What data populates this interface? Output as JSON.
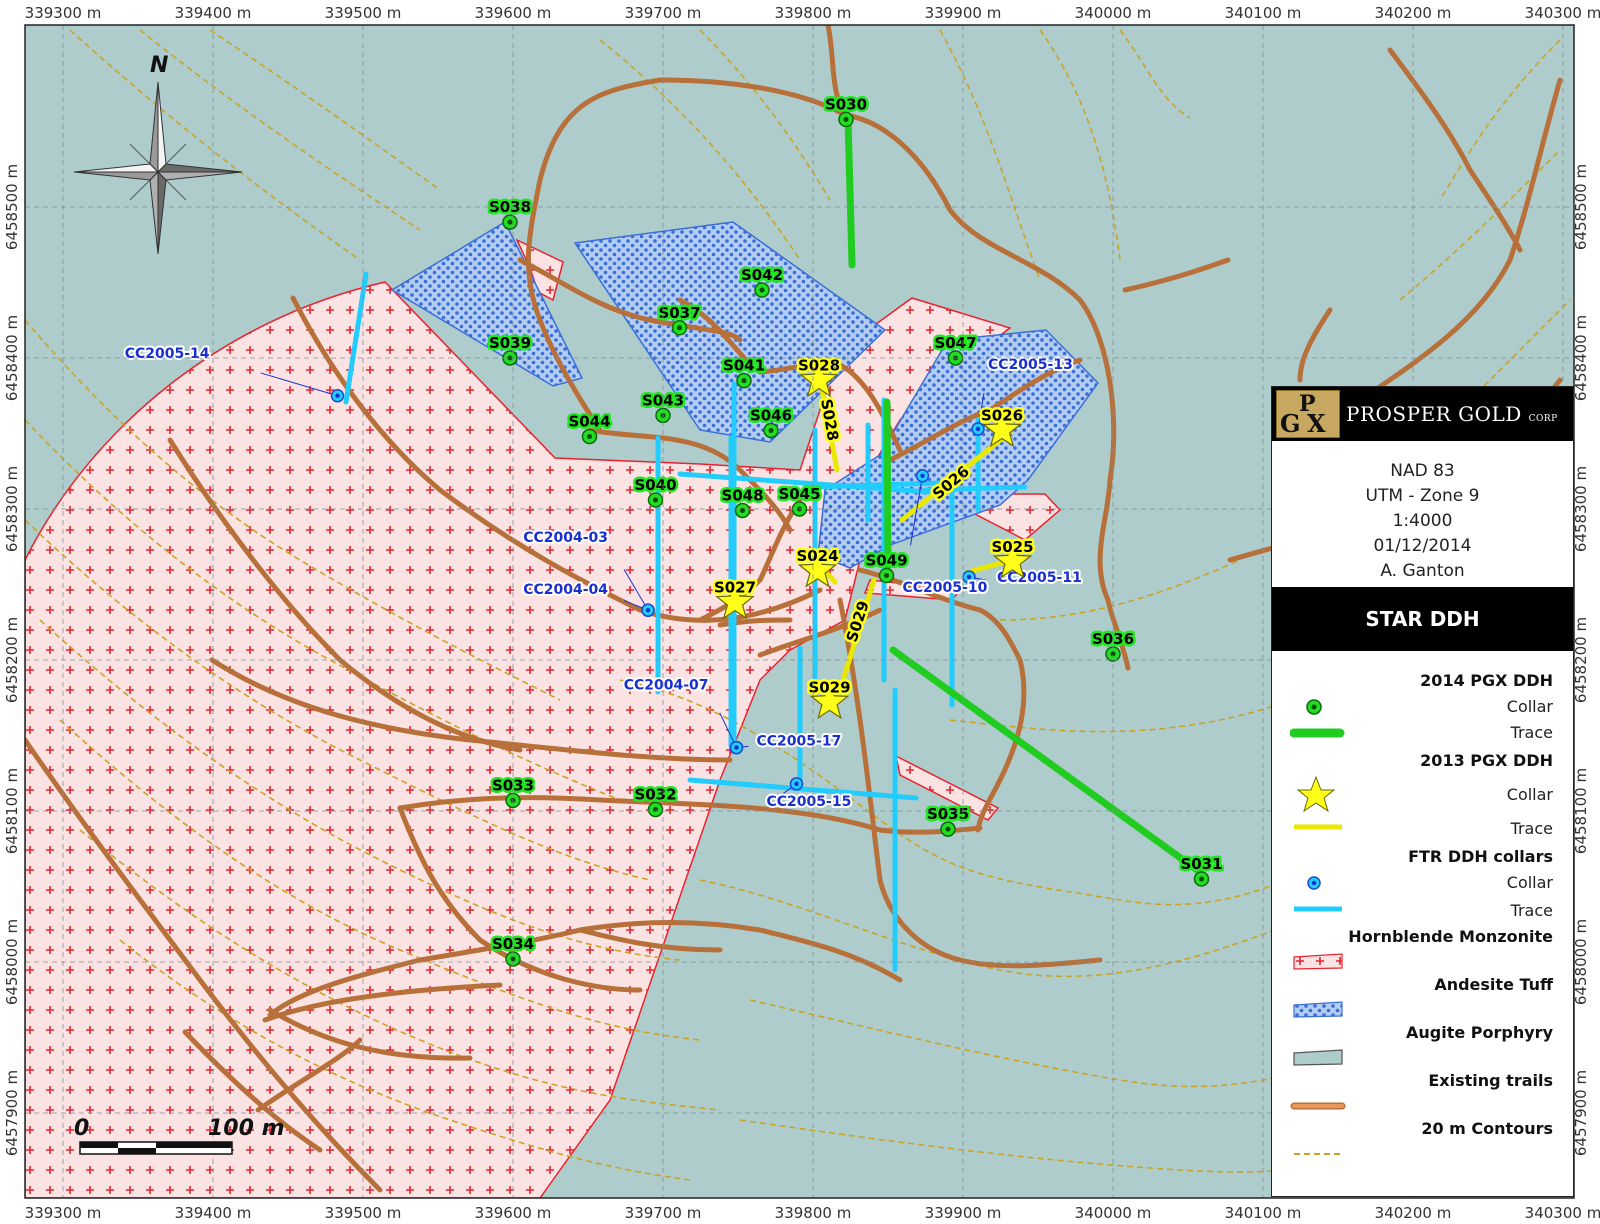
{
  "map": {
    "x_ticks": [
      "339300 m",
      "339400 m",
      "339500 m",
      "339600 m",
      "339700 m",
      "339800 m",
      "339900 m",
      "340000 m",
      "340100 m",
      "340200 m",
      "340300 m"
    ],
    "y_ticks": [
      "6458500 m",
      "6458400 m",
      "6458300 m",
      "6458200 m",
      "6458100 m",
      "6458000 m",
      "6457900 m"
    ],
    "north_label": "N",
    "scale": {
      "zero": "0",
      "end": "100 m"
    },
    "colors": {
      "augite": "#afcccd",
      "monzonite": "#fce3e3",
      "tuff": "#b3cdf2",
      "trail": "#e8995a",
      "contour": "#c9a424",
      "pgx2014": "#22dd22",
      "pgx2013": "#ffff1a",
      "ftr": "#22ccff"
    }
  },
  "holes_2014": [
    {
      "id": "S030",
      "x": 339822,
      "y": 6458558
    },
    {
      "id": "S038",
      "x": 339598,
      "y": 6458490
    },
    {
      "id": "S042",
      "x": 339766,
      "y": 6458445
    },
    {
      "id": "S037",
      "x": 339711,
      "y": 6458420
    },
    {
      "id": "S039",
      "x": 339598,
      "y": 6458400
    },
    {
      "id": "S041",
      "x": 339754,
      "y": 6458385
    },
    {
      "id": "S047",
      "x": 339895,
      "y": 6458400
    },
    {
      "id": "S043",
      "x": 339700,
      "y": 6458362
    },
    {
      "id": "S044",
      "x": 339651,
      "y": 6458348
    },
    {
      "id": "S046",
      "x": 339772,
      "y": 6458352
    },
    {
      "id": "S040",
      "x": 339695,
      "y": 6458306
    },
    {
      "id": "S048",
      "x": 339753,
      "y": 6458299
    },
    {
      "id": "S045",
      "x": 339791,
      "y": 6458300
    },
    {
      "id": "S049",
      "x": 339849,
      "y": 6458256
    },
    {
      "id": "S036",
      "x": 340000,
      "y": 6458204
    },
    {
      "id": "S033",
      "x": 339600,
      "y": 6458107
    },
    {
      "id": "S032",
      "x": 339695,
      "y": 6458101
    },
    {
      "id": "S035",
      "x": 339890,
      "y": 6458088
    },
    {
      "id": "S031",
      "x": 340059,
      "y": 6458055
    },
    {
      "id": "S034",
      "x": 339600,
      "y": 6458002
    }
  ],
  "holes_2013": [
    {
      "id": "S028",
      "x": 339804,
      "y": 6458385
    },
    {
      "id": "S026",
      "x": 339926,
      "y": 6458352
    },
    {
      "id": "S025",
      "x": 339933,
      "y": 6458265
    },
    {
      "id": "S024",
      "x": 339803,
      "y": 6458259
    },
    {
      "id": "S027",
      "x": 339748,
      "y": 6458238
    },
    {
      "id": "S029",
      "x": 339811,
      "y": 6458172
    }
  ],
  "ftr_collars": [
    {
      "id": "CC2005-14",
      "x": 339483,
      "y": 6458375
    },
    {
      "id": "CC2005-13",
      "x": 339910,
      "y": 6458353
    },
    {
      "id": "CC2004-03",
      "x": 339690,
      "y": 6458233
    },
    {
      "id": "CC2004-04",
      "x": 339690,
      "y": 6458233
    },
    {
      "id": "CC2005-11",
      "x": 339904,
      "y": 6458255
    },
    {
      "id": "CC2005-10",
      "x": 339873,
      "y": 6458322
    },
    {
      "id": "CC2004-07",
      "x": 339749,
      "y": 6458142
    },
    {
      "id": "CC2005-17",
      "x": 339749,
      "y": 6458142
    },
    {
      "id": "CC2005-15",
      "x": 339789,
      "y": 6458118
    }
  ],
  "legend": {
    "company": "PROSPER GOLD",
    "company_suffix": "CORP",
    "logo_letters": [
      "P",
      "G",
      "X"
    ],
    "datum": "NAD 83",
    "projection": "UTM - Zone 9",
    "scale": "1:4000",
    "date": "01/12/2014",
    "author": "A. Ganton",
    "title": "STAR  DDH",
    "sec_2014": "2014 PGX  DDH",
    "sec_2013": "2013 PGX DDH",
    "sec_ftr": "FTR DDH collars",
    "collar": "Collar",
    "trace": "Trace",
    "hornblende": "Hornblende Monzonite",
    "andesite": "Andesite Tuff",
    "augite": "Augite Porphyry",
    "trails": "Existing trails",
    "contours": "20 m Contours"
  }
}
